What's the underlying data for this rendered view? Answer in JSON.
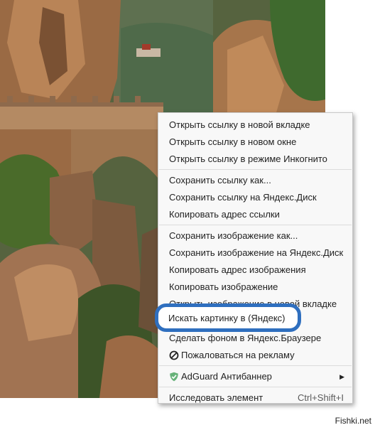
{
  "context_menu": {
    "groups": [
      [
        "Открыть ссылку в новой вкладке",
        "Открыть ссылку в новом окне",
        "Открыть ссылку в режиме Инкогнито"
      ],
      [
        "Сохранить ссылку как...",
        "Сохранить ссылку на Яндекс.Диск",
        "Копировать адрес ссылки"
      ],
      [
        "Сохранить изображение как...",
        "Сохранить изображение на Яндекс.Диск",
        "Копировать адрес изображения",
        "Копировать изображение",
        "Открыть изображение в новой вкладке",
        "Искать картинку в (Яндекс)",
        "Сделать фоном в Яндекс.Браузере"
      ]
    ],
    "report_ad": "Пожаловаться на рекламу",
    "adguard": "AdGuard Антибаннер",
    "inspect": "Исследовать элемент",
    "inspect_shortcut": "Ctrl+Shift+I"
  },
  "highlight_label": "Искать картинку в (Яндекс)",
  "watermark": "Fishki.net",
  "colors": {
    "highlight_border": "#2f6fbf",
    "adguard_green": "#67b279"
  }
}
